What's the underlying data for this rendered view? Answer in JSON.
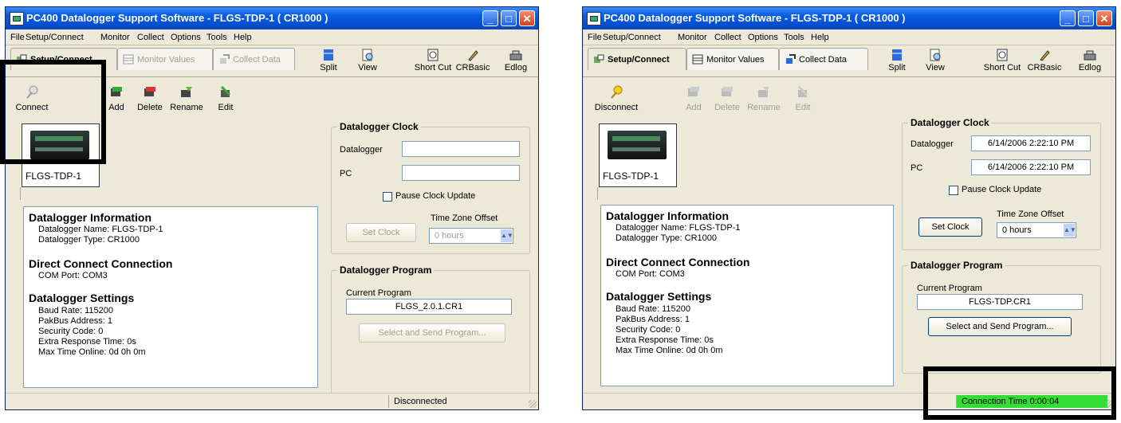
{
  "colors": {
    "title_bar": "#0a5ee0",
    "connection_time_bg": "#33dd33",
    "window_bg": "#ece9d8"
  },
  "windows": [
    {
      "title": "PC400 Datalogger Support Software - FLGS-TDP-1 ( CR1000 )",
      "menu": [
        "File",
        "Setup/Connect",
        "Monitor",
        "Collect",
        "Options",
        "Tools",
        "Help"
      ],
      "tabs": [
        "Setup/Connect",
        "Monitor Values",
        "Collect Data"
      ],
      "tools": [
        "Split",
        "View",
        "Short Cut",
        "CRBasic",
        "Edlog"
      ],
      "actions": [
        "Connect",
        "Add",
        "Delete",
        "Rename",
        "Edit"
      ],
      "device_label": "FLGS-TDP-1",
      "info": {
        "h1": "Datalogger Information",
        "name": "Datalogger Name: FLGS-TDP-1",
        "type": "Datalogger Type: CR1000",
        "h2": "Direct Connect Connection",
        "com": "COM Port: COM3",
        "h3": "Datalogger Settings",
        "baud": "Baud Rate: 115200",
        "pakbus": "PakBus Address: 1",
        "security": "Security Code: 0",
        "extra": "Extra Response Time: 0s",
        "maxtime": "Max Time Online: 0d 0h 0m"
      },
      "clock": {
        "title": "Datalogger Clock",
        "datalogger_label": "Datalogger",
        "datalogger_value": "",
        "pc_label": "PC",
        "pc_value": "",
        "pause_label": "Pause Clock Update",
        "set_clock": "Set Clock",
        "tz_label": "Time Zone Offset",
        "tz_value": "0 hours"
      },
      "program": {
        "title": "Datalogger Program",
        "current_label": "Current Program",
        "current_value": "FLGS_2.0.1.CR1",
        "send_button": "Select and Send Program..."
      },
      "status": "Disconnected"
    },
    {
      "title": "PC400 Datalogger Support Software - FLGS-TDP-1 ( CR1000 )",
      "menu": [
        "File",
        "Setup/Connect",
        "Monitor",
        "Collect",
        "Options",
        "Tools",
        "Help"
      ],
      "tabs": [
        "Setup/Connect",
        "Monitor Values",
        "Collect Data"
      ],
      "tools": [
        "Split",
        "View",
        "Short Cut",
        "CRBasic",
        "Edlog"
      ],
      "actions": [
        "Disconnect",
        "Add",
        "Delete",
        "Rename",
        "Edit"
      ],
      "device_label": "FLGS-TDP-1",
      "info": {
        "h1": "Datalogger Information",
        "name": "Datalogger Name: FLGS-TDP-1",
        "type": "Datalogger Type: CR1000",
        "h2": "Direct Connect Connection",
        "com": "COM Port: COM3",
        "h3": "Datalogger Settings",
        "baud": "Baud Rate: 115200",
        "pakbus": "PakBus Address: 1",
        "security": "Security Code: 0",
        "extra": "Extra Response Time: 0s",
        "maxtime": "Max Time Online: 0d 0h 0m"
      },
      "clock": {
        "title": "Datalogger Clock",
        "datalogger_label": "Datalogger",
        "datalogger_value": "6/14/2006 2:22:10 PM",
        "pc_label": "PC",
        "pc_value": "6/14/2006 2:22:10 PM",
        "pause_label": "Pause Clock Update",
        "set_clock": "Set Clock",
        "tz_label": "Time Zone Offset",
        "tz_value": "0 hours"
      },
      "program": {
        "title": "Datalogger Program",
        "current_label": "Current Program",
        "current_value": "FLGS-TDP.CR1",
        "send_button": "Select and Send Program..."
      },
      "status": "Connection Time 0:00:04"
    }
  ]
}
